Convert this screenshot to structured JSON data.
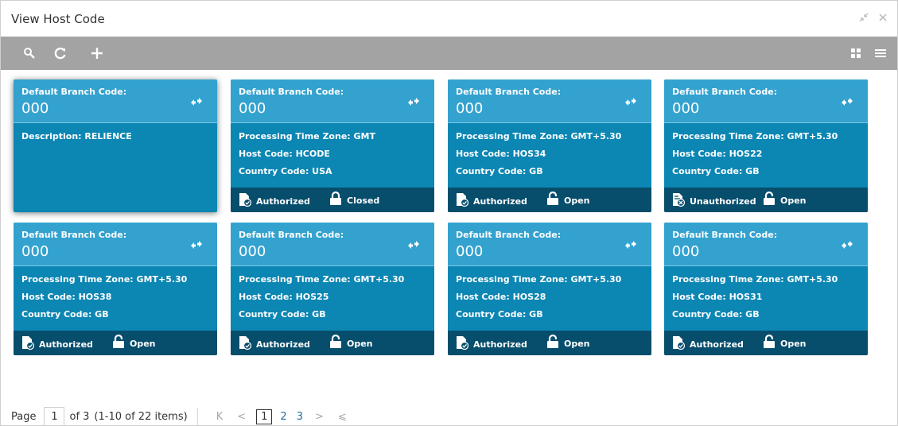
{
  "window": {
    "title": "View Host Code"
  },
  "toolbar": {
    "search": "search-icon",
    "refresh": "refresh-icon",
    "add": "plus-icon",
    "grid": "grid-view-icon",
    "list": "list-view-icon"
  },
  "colors": {
    "card_body": "#0c86b3",
    "card_header": "#34a2cf",
    "card_footer": "#074d6c",
    "toolbar": "#a3a3a3"
  },
  "cards": [
    {
      "label": "Default Branch Code:",
      "value": "000",
      "lines": [
        "Description: RELIENCE"
      ],
      "auth": "",
      "lock": ""
    },
    {
      "label": "Default Branch Code:",
      "value": "000",
      "lines": [
        "Processing Time Zone: GMT",
        "Host Code: HCODE",
        "Country Code: USA"
      ],
      "auth": "Authorized",
      "lock": "Closed"
    },
    {
      "label": "Default Branch Code:",
      "value": "000",
      "lines": [
        "Processing Time Zone: GMT+5.30",
        "Host Code: HOS34",
        "Country Code: GB"
      ],
      "auth": "Authorized",
      "lock": "Open"
    },
    {
      "label": "Default Branch Code:",
      "value": "000",
      "lines": [
        "Processing Time Zone: GMT+5.30",
        "Host Code: HOS22",
        "Country Code: GB"
      ],
      "auth": "Unauthorized",
      "lock": "Open"
    },
    {
      "label": "Default Branch Code:",
      "value": "000",
      "lines": [
        "Processing Time Zone: GMT+5.30",
        "Host Code: HOS38",
        "Country Code: GB"
      ],
      "auth": "Authorized",
      "lock": "Open"
    },
    {
      "label": "Default Branch Code:",
      "value": "000",
      "lines": [
        "Processing Time Zone: GMT+5.30",
        "Host Code: HOS25",
        "Country Code: GB"
      ],
      "auth": "Authorized",
      "lock": "Open"
    },
    {
      "label": "Default Branch Code:",
      "value": "000",
      "lines": [
        "Processing Time Zone: GMT+5.30",
        "Host Code: HOS28",
        "Country Code: GB"
      ],
      "auth": "Authorized",
      "lock": "Open"
    },
    {
      "label": "Default Branch Code:",
      "value": "000",
      "lines": [
        "Processing Time Zone: GMT+5.30",
        "Host Code: HOS31",
        "Country Code: GB"
      ],
      "auth": "Authorized",
      "lock": "Open"
    }
  ],
  "pager": {
    "page_label": "Page",
    "current": "1",
    "of_text": "of 3",
    "items_text": "(1-10 of 22 items)",
    "first": "K",
    "prev": "<",
    "pages": [
      "1",
      "2",
      "3"
    ],
    "next": ">",
    "last": "⩽"
  }
}
